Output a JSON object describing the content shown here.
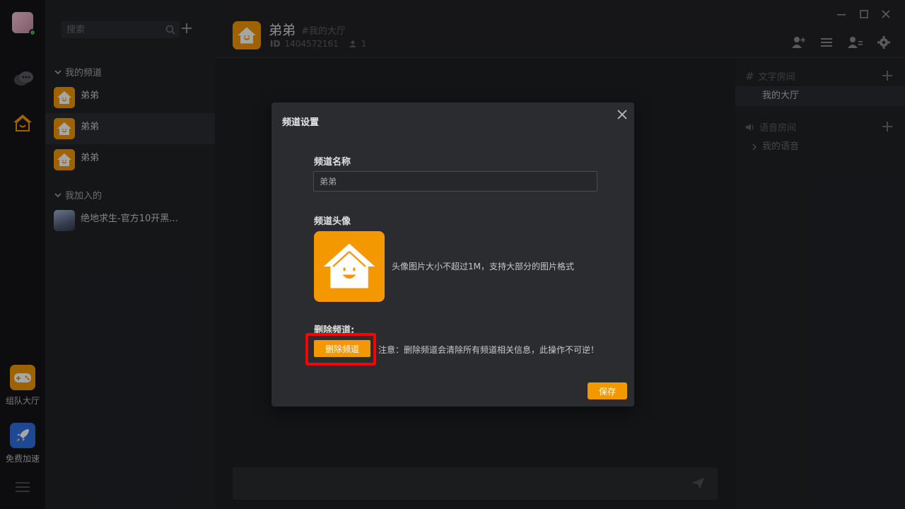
{
  "rail": {
    "apps": [
      {
        "label": "组队大厅",
        "color": "#f39800"
      },
      {
        "label": "免费加速",
        "color": "#2f6fe0"
      }
    ]
  },
  "sidebar": {
    "search_placeholder": "搜索",
    "groups": {
      "mine": {
        "label": "我的频道",
        "items": [
          "弟弟",
          "弟弟",
          "弟弟"
        ]
      },
      "joined": {
        "label": "我加入的",
        "items": [
          "绝地求生-官方10开黑..."
        ]
      }
    }
  },
  "header": {
    "title": "弟弟",
    "subroom": "#我的大厅",
    "id_label": "ID",
    "id_value": "1404572161",
    "member_count": "1"
  },
  "rooms": {
    "text_section": "文字房间",
    "text_items": [
      "我的大厅"
    ],
    "voice_section": "语音房间",
    "voice_items": [
      "我的语音"
    ]
  },
  "modal": {
    "title": "频道设置",
    "name_label": "频道名称",
    "name_value": "弟弟",
    "avatar_label": "频道头像",
    "avatar_hint": "头像图片大小不超过1M，支持大部分的图片格式",
    "delete_label": "删除频道:",
    "delete_button": "删除频道",
    "delete_note": "注意：删除频道会清除所有频道相关信息，此操作不可逆！",
    "save_button": "保存"
  },
  "colors": {
    "accent": "#f39800",
    "highlight": "#ff0000"
  }
}
